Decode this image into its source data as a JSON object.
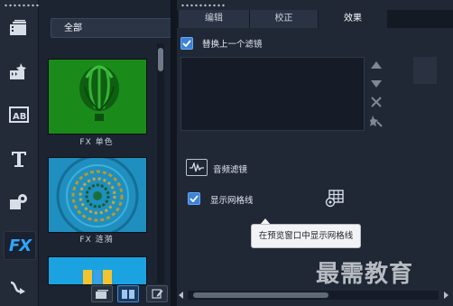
{
  "library": {
    "filter_value": "全部",
    "items": [
      {
        "label": "FX 单色"
      },
      {
        "label": "FX 涟漪"
      },
      {
        "label": ""
      }
    ]
  },
  "sidebar": {
    "fx_label": "FX",
    "items": [
      "media-icon",
      "transitions-icon",
      "title-ab-icon",
      "text-t-icon",
      "graphics-icon",
      "fx-filters-icon",
      "path-icon"
    ]
  },
  "options": {
    "tabs": [
      {
        "label": "编辑"
      },
      {
        "label": "校正"
      },
      {
        "label": "效果"
      }
    ],
    "active_tab": "效果",
    "replace_filter_label": "替换上一个滤镜",
    "replace_filter_checked": true,
    "audio_filter_label": "音频滤镜",
    "show_grid_label": "显示网格线",
    "show_grid_checked": true,
    "tooltip": "在预览窗口中显示网格线"
  },
  "watermark": "最需教育",
  "colors": {
    "accent": "#3b82d9",
    "fx_blue": "#2fa6ff",
    "panel_bg": "#202836"
  }
}
